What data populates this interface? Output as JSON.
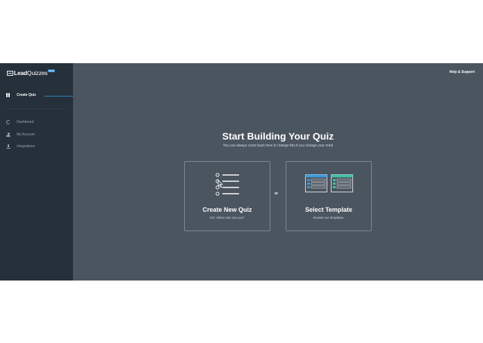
{
  "logo": {
    "lead": "Lead",
    "quizzes": "Quizzes",
    "badge": "BETA"
  },
  "sidebar": {
    "active_item": {
      "label": "Create Quiz",
      "icon": "pause-bars-icon"
    },
    "items": [
      {
        "label": "Dashboard",
        "icon": "dashboard-icon"
      },
      {
        "label": "My Account",
        "icon": "user-icon"
      },
      {
        "label": "Integrations",
        "icon": "integrations-icon"
      }
    ]
  },
  "header": {
    "help_link": "Help & Support"
  },
  "main": {
    "title_regular": "Start Building ",
    "title_bold": "Your Quiz",
    "subtitle": "You can always come back here to change this if you change your mind",
    "or_label": "or",
    "cards": [
      {
        "title": "Create New Quiz",
        "description": "EG. What color are you?",
        "icon": "checklist-icon"
      },
      {
        "title": "Select Template",
        "description": "Browse our templates.",
        "icon": "templates-icon"
      }
    ]
  },
  "colors": {
    "sidebar_bg": "#25303b",
    "main_bg": "#4b5560",
    "accent": "#2f86c0",
    "template_blue": "#3a9ad9",
    "template_teal": "#3fc1a5"
  }
}
